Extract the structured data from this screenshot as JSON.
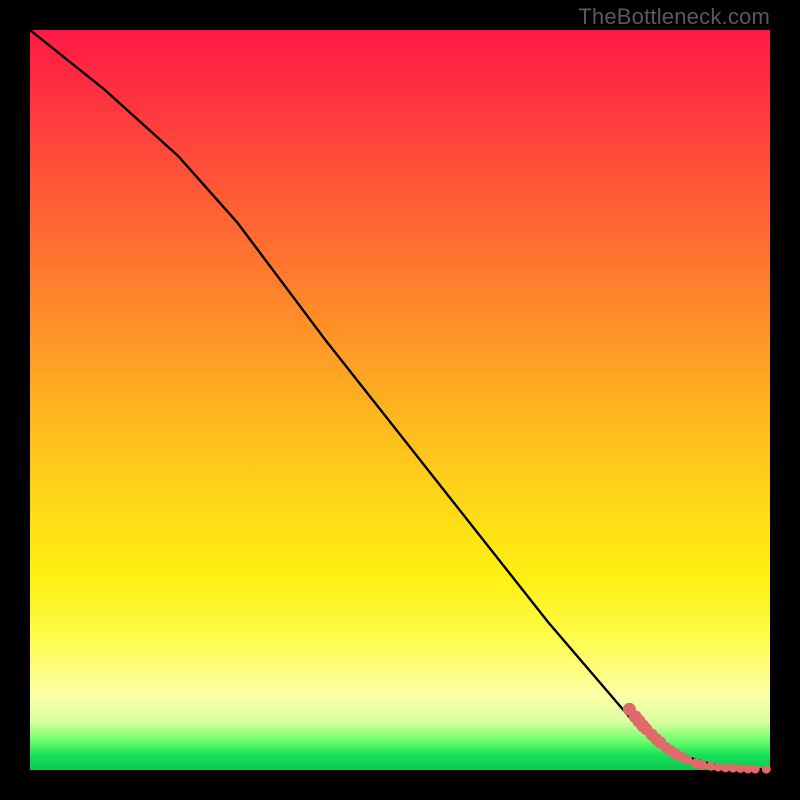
{
  "attribution": "TheBottleneck.com",
  "chart_data": {
    "type": "line",
    "title": "",
    "xlabel": "",
    "ylabel": "",
    "xlim": [
      0,
      100
    ],
    "ylim": [
      0,
      100
    ],
    "series": [
      {
        "name": "curve",
        "x": [
          0,
          10,
          20,
          28,
          40,
          55,
          70,
          82,
          88,
          92,
          95,
          98,
          100
        ],
        "y": [
          100,
          92,
          83,
          74,
          58,
          39,
          20,
          6,
          2,
          0.8,
          0.3,
          0.1,
          0.1
        ]
      }
    ],
    "markers": {
      "name": "points",
      "color": "#e06a6a",
      "items": [
        {
          "x": 81.0,
          "y": 8.2,
          "r": 6.5
        },
        {
          "x": 81.8,
          "y": 7.2,
          "r": 6.5
        },
        {
          "x": 82.3,
          "y": 6.6,
          "r": 6.5
        },
        {
          "x": 82.8,
          "y": 6.0,
          "r": 6.5
        },
        {
          "x": 83.3,
          "y": 5.5,
          "r": 6.0
        },
        {
          "x": 84.0,
          "y": 4.8,
          "r": 6.0
        },
        {
          "x": 84.6,
          "y": 4.2,
          "r": 6.0
        },
        {
          "x": 85.2,
          "y": 3.7,
          "r": 6.0
        },
        {
          "x": 86.0,
          "y": 3.0,
          "r": 5.5
        },
        {
          "x": 86.6,
          "y": 2.6,
          "r": 5.5
        },
        {
          "x": 87.2,
          "y": 2.2,
          "r": 5.5
        },
        {
          "x": 88.0,
          "y": 1.8,
          "r": 5.0
        },
        {
          "x": 88.8,
          "y": 1.4,
          "r": 5.0
        },
        {
          "x": 90.0,
          "y": 0.9,
          "r": 5.0
        },
        {
          "x": 90.8,
          "y": 0.7,
          "r": 5.0
        },
        {
          "x": 92.0,
          "y": 0.5,
          "r": 4.5
        },
        {
          "x": 93.0,
          "y": 0.4,
          "r": 4.5
        },
        {
          "x": 94.0,
          "y": 0.3,
          "r": 4.5
        },
        {
          "x": 95.0,
          "y": 0.25,
          "r": 4.5
        },
        {
          "x": 96.0,
          "y": 0.2,
          "r": 4.5
        },
        {
          "x": 97.0,
          "y": 0.15,
          "r": 4.5
        },
        {
          "x": 98.0,
          "y": 0.12,
          "r": 4.5
        },
        {
          "x": 99.5,
          "y": 0.12,
          "r": 4.5
        }
      ]
    }
  }
}
